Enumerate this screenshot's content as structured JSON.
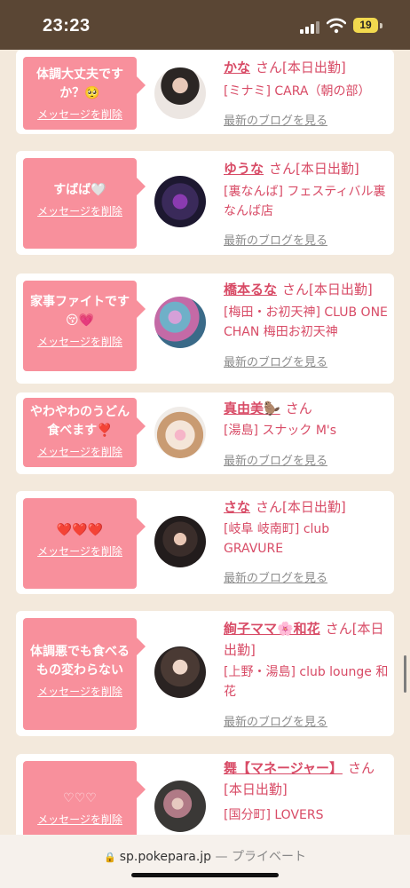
{
  "status_bar": {
    "time": "23:23",
    "battery": "19"
  },
  "cards": [
    {
      "message": "体調大丈夫ですか？🥺",
      "delete_label": "メッセージを削除",
      "name": "かな",
      "san": "さん",
      "status": "[本日出勤]",
      "shop": "[ミナミ] CARA（朝の部）",
      "blog": "最新のブログを見る"
    },
    {
      "message": "すばば🤍",
      "delete_label": "メッセージを削除",
      "name": "ゆうな",
      "san": "さん",
      "status": "[本日出勤]",
      "shop": "[裏なんば] フェスティバル裏なんば店",
      "blog": "最新のブログを見る"
    },
    {
      "message": "家事ファイトです😚💗",
      "delete_label": "メッセージを削除",
      "name": "橋本るな",
      "san": "さん",
      "status": "[本日出勤]",
      "shop": "[梅田・お初天神] CLUB ONE CHAN 梅田お初天神",
      "blog": "最新のブログを見る"
    },
    {
      "message": "やわやわのうどん食べます❣️",
      "delete_label": "メッセージを削除",
      "name": "真由美🦫",
      "san": "さん",
      "status": "",
      "shop": "[湯島] スナック M's",
      "blog": "最新のブログを見る"
    },
    {
      "message": "❤️❤️❤️",
      "delete_label": "メッセージを削除",
      "name": "さな",
      "san": "さん",
      "status": "[本日出勤]",
      "shop": "[岐阜 岐南町] club GRAVURE",
      "blog": "最新のブログを見る"
    },
    {
      "message": "体調悪でも食べるもの変わらない",
      "delete_label": "メッセージを削除",
      "name": "絢子ママ🌸和花",
      "san": "さん",
      "status": "[本日出勤]",
      "shop": "[上野・湯島] club lounge 和花",
      "blog": "最新のブログを見る"
    },
    {
      "message": "♡♡♡",
      "delete_label": "メッセージを削除",
      "name": "舞【マネージャー】",
      "san": "さん",
      "status": "[本日出勤]",
      "shop": "[国分町] LOVERS",
      "blog": ""
    }
  ],
  "url_bar": {
    "domain": "sp.pokepara.jp",
    "separator": "—",
    "mode": "プライベート"
  },
  "colors": {
    "accent": "#d84b66",
    "bubble": "#f8909c",
    "background": "#f3e9dc",
    "status_bar": "#5a4634"
  }
}
